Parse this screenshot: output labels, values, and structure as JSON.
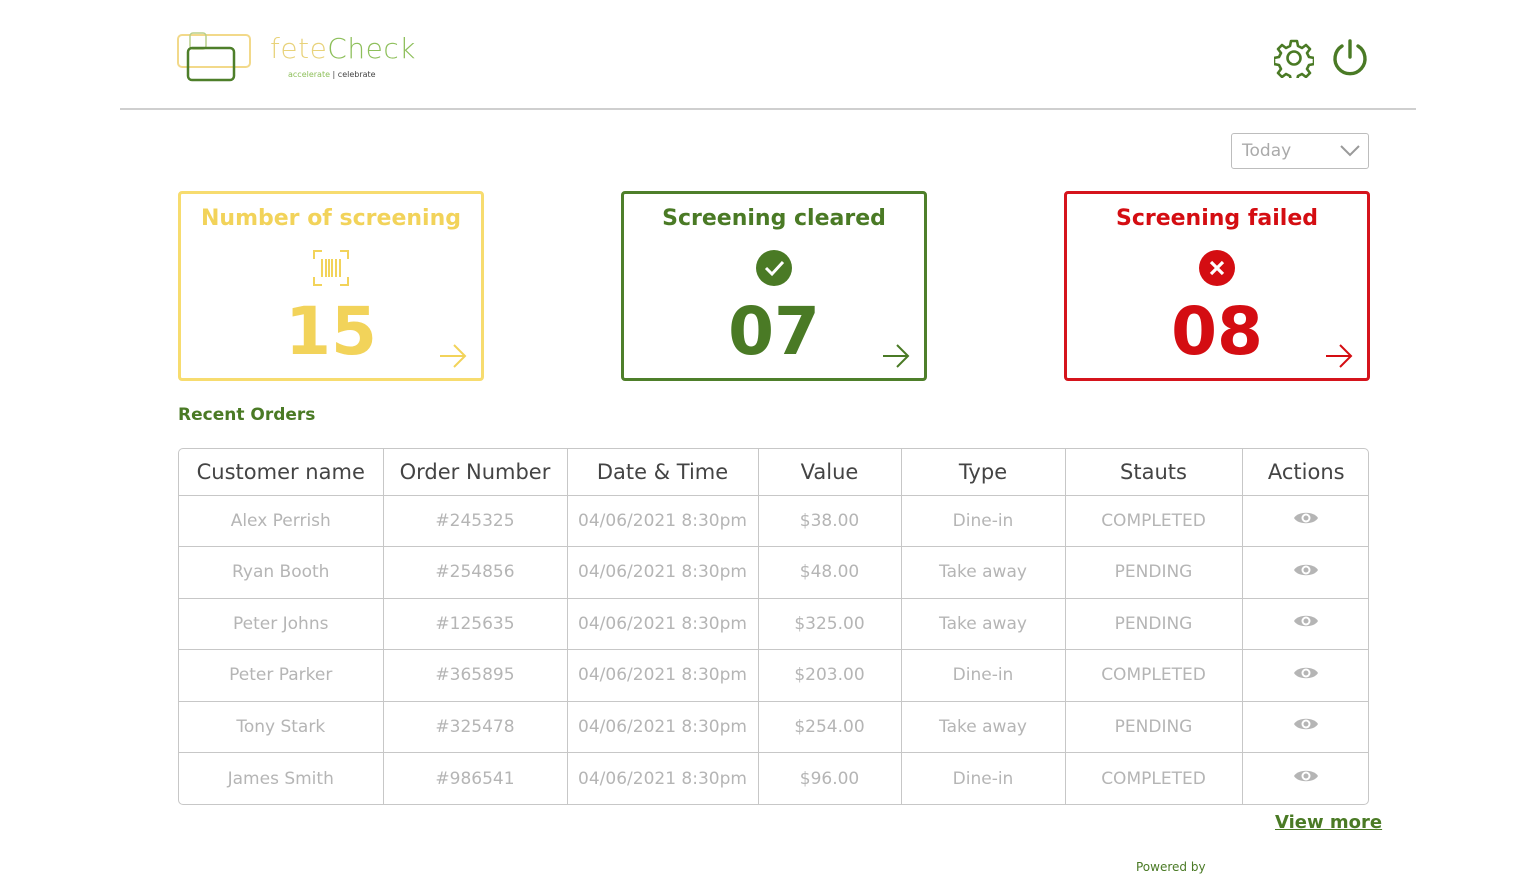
{
  "brand": {
    "name_part1": "fete",
    "name_part2": "Check",
    "tagline_part1": "accelerate",
    "tagline_sep": " | ",
    "tagline_part2": "celebrate"
  },
  "header": {
    "icons": [
      "gear-icon",
      "power-icon"
    ]
  },
  "filter": {
    "selected": "Today"
  },
  "cards": {
    "total": {
      "title": "Number of screening",
      "value": "15",
      "icon": "barcode-scan-icon"
    },
    "cleared": {
      "title": "Screening cleared",
      "value": "07",
      "icon": "check-circle-icon"
    },
    "failed": {
      "title": "Screening failed",
      "value": "08",
      "icon": "x-circle-icon"
    }
  },
  "orders": {
    "title": "Recent Orders",
    "columns": [
      "Customer name",
      "Order Number",
      "Date & Time",
      "Value",
      "Type",
      "Stauts",
      "Actions"
    ],
    "rows": [
      [
        "Alex Perrish",
        "#245325",
        "04/06/2021 8:30pm",
        "$38.00",
        "Dine-in",
        "COMPLETED"
      ],
      [
        "Ryan Booth",
        "#254856",
        "04/06/2021 8:30pm",
        "$48.00",
        "Take away",
        "PENDING"
      ],
      [
        "Peter Johns",
        "#125635",
        "04/06/2021 8:30pm",
        "$325.00",
        "Take away",
        "PENDING"
      ],
      [
        "Peter Parker",
        "#365895",
        "04/06/2021 8:30pm",
        "$203.00",
        "Dine-in",
        "COMPLETED"
      ],
      [
        "Tony Stark",
        "#325478",
        "04/06/2021 8:30pm",
        "$254.00",
        "Take away",
        "PENDING"
      ],
      [
        "James Smith",
        "#986541",
        "04/06/2021 8:30pm",
        "$96.00",
        "Dine-in",
        "COMPLETED"
      ]
    ],
    "view_more": "View more"
  },
  "footer": {
    "powered_by": "Powered by"
  },
  "colors": {
    "yellow": "#f2d35a",
    "green": "#4a7a25",
    "red": "#d40d12"
  }
}
